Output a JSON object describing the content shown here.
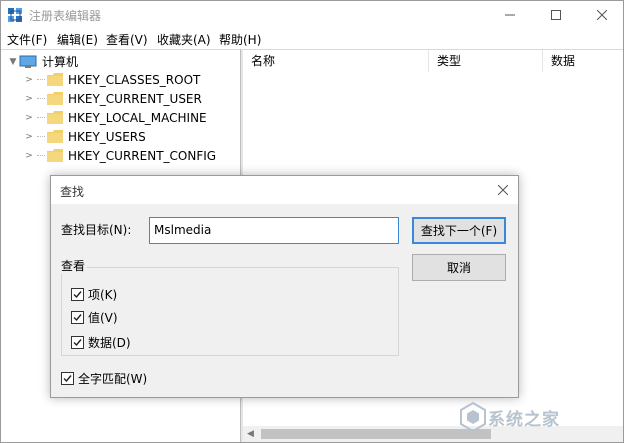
{
  "window": {
    "title": "注册表编辑器",
    "minimize_icon": "minimize-icon",
    "maximize_icon": "maximize-icon",
    "close_icon": "close-icon"
  },
  "menu": [
    {
      "label": "文件(F)"
    },
    {
      "label": "编辑(E)"
    },
    {
      "label": "查看(V)"
    },
    {
      "label": "收藏夹(A)"
    },
    {
      "label": "帮助(H)"
    }
  ],
  "tree": {
    "root": {
      "label": "计算机",
      "icon": "computer-icon",
      "expanded": true
    },
    "items": [
      {
        "label": "HKEY_CLASSES_ROOT",
        "icon": "folder-icon"
      },
      {
        "label": "HKEY_CURRENT_USER",
        "icon": "folder-icon"
      },
      {
        "label": "HKEY_LOCAL_MACHINE",
        "icon": "folder-icon"
      },
      {
        "label": "HKEY_USERS",
        "icon": "folder-icon"
      },
      {
        "label": "HKEY_CURRENT_CONFIG",
        "icon": "folder-icon"
      }
    ]
  },
  "list": {
    "columns": [
      {
        "label": "名称"
      },
      {
        "label": "类型"
      },
      {
        "label": "数据"
      }
    ]
  },
  "find_dialog": {
    "title": "查找",
    "target_label": "查找目标(N):",
    "target_value": "Mslmedia",
    "find_next_label": "查找下一个(F)",
    "cancel_label": "取消",
    "look_at_label": "查看",
    "options": [
      {
        "label": "项(K)",
        "checked": true
      },
      {
        "label": "值(V)",
        "checked": true
      },
      {
        "label": "数据(D)",
        "checked": true
      }
    ],
    "match_whole": {
      "label": "全字匹配(W)",
      "checked": true
    }
  },
  "watermark": {
    "text": "系统之家"
  },
  "colors": {
    "accent": "#3c88d8",
    "folder": "#f2cf69",
    "dialog_bg": "#f0f0f0",
    "title_gray": "#9a9a9a"
  }
}
